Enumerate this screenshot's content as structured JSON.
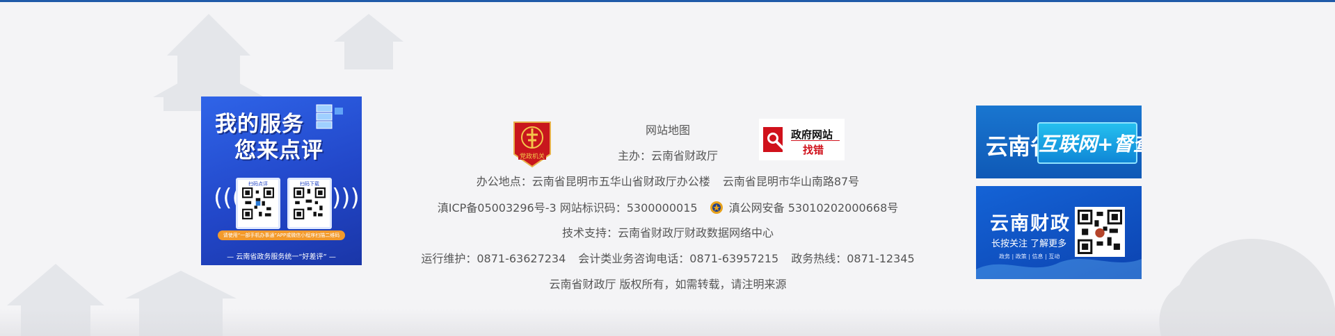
{
  "left_poster": {
    "title_line1": "我的服务",
    "title_line2": "您来点评",
    "qr_a_caption": "扫码点评",
    "qr_b_caption": "扫码下载",
    "banner": "请使用“一部手机办事通”APP或微信小程序扫描二维码",
    "footer": "— 云南省政务服务统一“好差评” —"
  },
  "footer": {
    "sitemap": "网站地图",
    "host": "主办：云南省财政厅",
    "address": "办公地点：云南省昆明市五华山省财政厅办公楼",
    "address2": "云南省昆明市华山南路87号",
    "icp": "滇ICP备05003296号-3",
    "site_id": "网站标识码：5300000015",
    "police_record": "滇公网安备 53010202000668号",
    "tech_support": "技术支持：云南省财政厅财政数据网络中心",
    "maintenance": "运行维护：0871-63627234",
    "accounting_hotline": "会计类业务咨询电话：0871-63957215",
    "gov_hotline": "政务热线：0871-12345",
    "copyright": "云南省财政厅 版权所有，如需转载，请注明来源"
  },
  "badge": {
    "text": "党政机关"
  },
  "error_report": {
    "line1": "政府网站",
    "line2": "找错"
  },
  "right_banners": {
    "b1_prefix": "云南省",
    "b1_main": "互联网+督查",
    "b2_title": "云南财政",
    "b2_sub": "长按关注  了解更多",
    "b2_tags": "政务 | 政策 | 信息 | 互动"
  },
  "colors": {
    "accent": "#1f5aa8",
    "badge_red": "#c8161d",
    "error_red": "#d0111b",
    "poster_blue": "#2247c9"
  }
}
